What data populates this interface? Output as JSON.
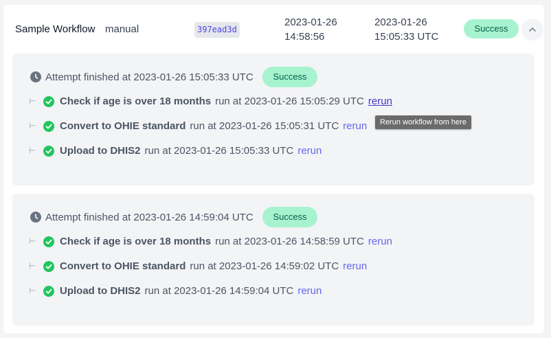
{
  "workflow": {
    "name": "Sample Workflow",
    "trigger": "manual",
    "hash": "397ead3d",
    "started_date": "2023-01-26",
    "started_time": "14:58:56",
    "finished_date": "2023-01-26",
    "finished_time": "15:05:33 UTC",
    "status": "Success",
    "toggle_icon": "chevron-up-icon"
  },
  "attempts": [
    {
      "finished_text": "Attempt finished at 2023-01-26 15:05:33 UTC",
      "status": "Success",
      "steps": [
        {
          "name": "Check if age is over 18 months",
          "run_text": "run at 2023-01-26 15:05:29 UTC",
          "rerun": "rerun"
        },
        {
          "name": "Convert to OHIE standard",
          "run_text": "run at 2023-01-26 15:05:31 UTC",
          "rerun": "rerun"
        },
        {
          "name": "Upload to DHIS2",
          "run_text": "run at 2023-01-26 15:05:33 UTC",
          "rerun": "rerun"
        }
      ]
    },
    {
      "finished_text": "Attempt finished at 2023-01-26 14:59:04 UTC",
      "status": "Success",
      "steps": [
        {
          "name": "Check if age is over 18 months",
          "run_text": "run at 2023-01-26 14:58:59 UTC",
          "rerun": "rerun"
        },
        {
          "name": "Convert to OHIE standard",
          "run_text": "run at 2023-01-26 14:59:02 UTC",
          "rerun": "rerun"
        },
        {
          "name": "Upload to DHIS2",
          "run_text": "run at 2023-01-26 14:59:04 UTC",
          "rerun": "rerun"
        }
      ]
    }
  ],
  "tooltip": "Rerun workflow from here",
  "icons": {
    "clock": "clock-icon",
    "check": "check-circle-icon",
    "connector": "step-connector-icon"
  },
  "colors": {
    "success_bg": "#a7f3d0",
    "success_text": "#065f46",
    "check": "#22c55e",
    "link": "#6366f1"
  }
}
